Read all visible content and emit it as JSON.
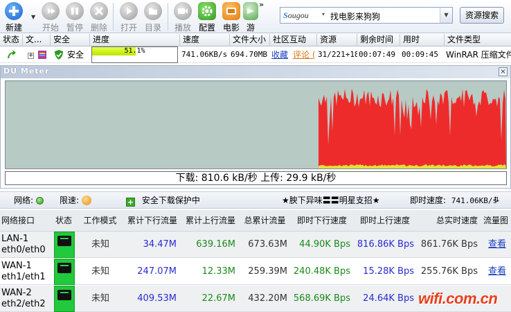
{
  "toolbar": {
    "buttons": [
      {
        "id": "new",
        "label": "新建",
        "icon": "plus-icon",
        "enabled": true
      },
      {
        "id": "start",
        "label": "开始",
        "icon": "play-icon",
        "enabled": false
      },
      {
        "id": "pause",
        "label": "暂停",
        "icon": "pause-icon",
        "enabled": false
      },
      {
        "id": "delete",
        "label": "删除",
        "icon": "delete-icon",
        "enabled": false
      },
      {
        "id": "open",
        "label": "打开",
        "icon": "play-icon",
        "enabled": false
      },
      {
        "id": "folder",
        "label": "目录",
        "icon": "folder-icon",
        "enabled": false
      },
      {
        "id": "play",
        "label": "播放",
        "icon": "video-icon",
        "enabled": false
      },
      {
        "id": "config",
        "label": "配置",
        "icon": "gear-icon",
        "enabled": true
      },
      {
        "id": "movie",
        "label": "电影",
        "icon": "tv-icon",
        "enabled": true
      },
      {
        "id": "game",
        "label": "游",
        "icon": "game-icon",
        "enabled": true
      }
    ],
    "more": "»",
    "search": {
      "engine": "Sougou",
      "engine_prefix": "S",
      "engine_rest": "ougou",
      "caret": "▾",
      "query": "找电影来狗狗",
      "button": "资源搜索"
    }
  },
  "download_list": {
    "columns": [
      "状态",
      "文...",
      "安全",
      "进度",
      "速度",
      "文件大小",
      "社区互动",
      "资源",
      "剩余时间",
      "用时",
      "文件类型"
    ],
    "rows": [
      {
        "expand": "+",
        "safety": "安全",
        "progress_pct": 51.1,
        "progress_label": "51.1%",
        "speed": "741.06KB/s",
        "size": "694.70MB",
        "favorite": "收藏",
        "comment": "评论 (",
        "resources": "31/221+18",
        "remaining": "00:07:49",
        "elapsed": "00:09:45",
        "filetype": "WinRAR 压缩文件"
      }
    ]
  },
  "du_meter": {
    "title": "DU Meter",
    "close": "×",
    "readout": "下载: 810.6 kB/秒  上传: 29.9 kB/秒",
    "colors": {
      "background": "#b7cac4",
      "download": "#ee2b2b",
      "upload": "#e2e23a"
    },
    "activity_start_fraction": 0.625
  },
  "status_bar": {
    "network_label": "网络:",
    "limit_label": "限速:",
    "protect_label": "安全下载保护中",
    "ad_text": "★腴下异味〓〓明星支招★",
    "instant_speed_label": "即时速度:",
    "instant_speed_value": "741.06KB/s",
    "arrow": "⇅"
  },
  "network": {
    "columns": [
      "网络接口",
      "状态",
      "工作模式",
      "累计下行流量",
      "累计上行流量",
      "总累计流量",
      "即时下行速度",
      "即时上行速度",
      "总实时速度",
      "流量图"
    ],
    "rows": [
      {
        "iface1": "LAN-1",
        "iface2": "eth0/eth0",
        "mode": "未知",
        "down_total": "34.47M",
        "up_total": "639.16M",
        "total": "673.63M",
        "down_speed": "44.90K Bps",
        "up_speed": "816.86K Bps",
        "total_speed": "861.76K Bps",
        "view": "查看"
      },
      {
        "iface1": "WAN-1",
        "iface2": "eth1/eth1",
        "mode": "未知",
        "down_total": "247.07M",
        "up_total": "12.33M",
        "total": "259.39M",
        "down_speed": "240.48K Bps",
        "up_speed": "15.28K Bps",
        "total_speed": "255.76K Bps",
        "view": "查看"
      },
      {
        "iface1": "WAN-2",
        "iface2": "eth2/eth2",
        "mode": "未知",
        "down_total": "409.53M",
        "up_total": "22.67M",
        "total": "432.20M",
        "down_speed": "568.69K Bps",
        "up_speed": "24.64K Bps",
        "total_speed": "",
        "view": ""
      }
    ]
  },
  "watermark": "wifi.com.cn"
}
